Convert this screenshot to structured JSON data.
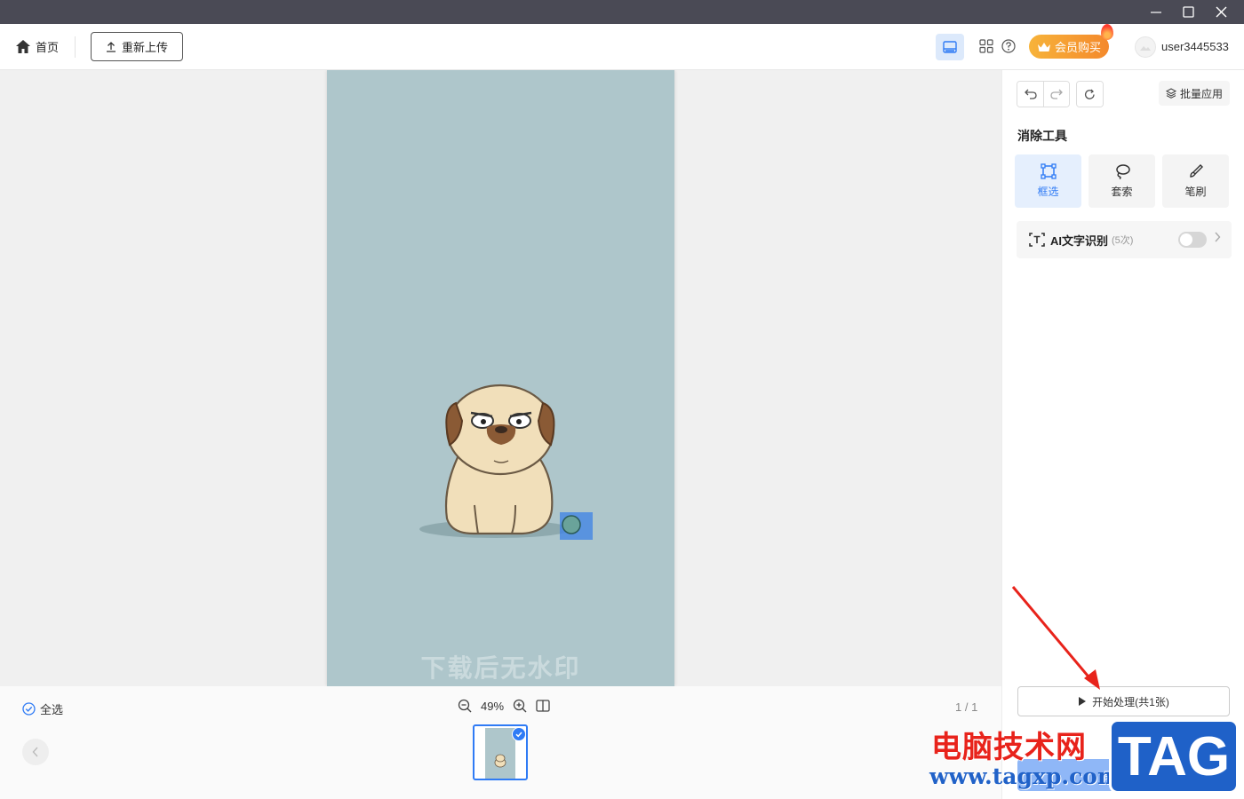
{
  "window": {
    "minimize_icon": "minimize-icon",
    "maximize_icon": "maximize-icon",
    "close_icon": "close-icon"
  },
  "toolbar": {
    "home_label": "首页",
    "reupload_label": "重新上传",
    "vip_label": "会员购买",
    "username": "user3445533"
  },
  "canvas": {
    "watermark_text": "下载后无水印"
  },
  "bottom": {
    "select_all_label": "全选",
    "zoom_level": "49%",
    "pager": "1 / 1"
  },
  "panel": {
    "batch_label": "批量应用",
    "section_title": "消除工具",
    "tools": [
      {
        "label": "框选",
        "icon": "rect-select-icon",
        "active": true
      },
      {
        "label": "套索",
        "icon": "lasso-icon",
        "active": false
      },
      {
        "label": "笔刷",
        "icon": "brush-icon",
        "active": false
      }
    ],
    "ai_label": "AI文字识别",
    "ai_count": "(5次)",
    "ai_enabled": false,
    "process_label": "开始处理(共1张)",
    "save_label": "保存全部"
  },
  "overlay": {
    "site_name": "电脑技术网",
    "site_url": "www.tagxp.com",
    "site_tag": "TAG"
  },
  "colors": {
    "accent": "#2f7bf5",
    "image_bg": "#aec6cb",
    "vip_gradient_start": "#f7b33a",
    "vip_gradient_end": "#f4892c",
    "annotation": "#e8231b"
  }
}
